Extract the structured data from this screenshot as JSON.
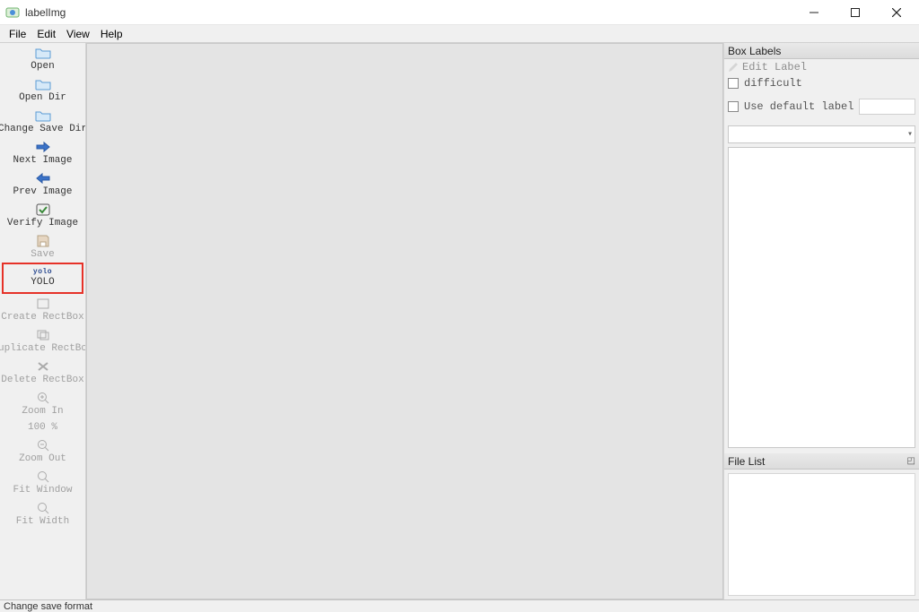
{
  "window": {
    "title": "labelImg"
  },
  "menubar": {
    "items": [
      "File",
      "Edit",
      "View",
      "Help"
    ]
  },
  "toolbar": {
    "open": "Open",
    "open_dir": "Open Dir",
    "change_save_dir": "Change Save Dir",
    "next_image": "Next Image",
    "prev_image": "Prev Image",
    "verify_image": "Verify Image",
    "save": "Save",
    "yolo_tag": "yolo",
    "yolo": "YOLO",
    "create_rectbox": "Create RectBox",
    "duplicate_rectbox": "Duplicate RectBox",
    "delete_rectbox": "Delete RectBox",
    "zoom_in": "Zoom In",
    "zoom_pct": "100 %",
    "zoom_out": "Zoom Out",
    "fit_window": "Fit Window",
    "fit_width": "Fit Width"
  },
  "right": {
    "box_labels_title": "Box Labels",
    "edit_label": "Edit Label",
    "difficult": "difficult",
    "use_default_label": "Use default label",
    "file_list_title": "File List"
  },
  "status": {
    "text": "Change save format"
  }
}
